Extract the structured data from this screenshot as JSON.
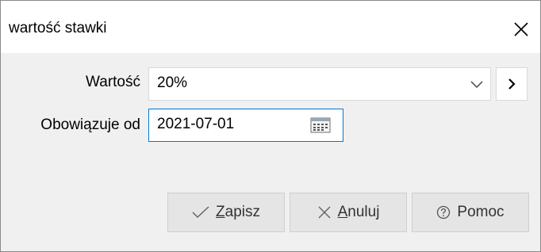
{
  "dialog": {
    "title": "wartość stawki"
  },
  "form": {
    "value_label": "Wartość",
    "value": "20%",
    "valid_from_label": "Obowiązuje od",
    "valid_from": "2021-07-01"
  },
  "buttons": {
    "save_first": "Z",
    "save_rest": "apisz",
    "cancel_first": "A",
    "cancel_rest": "nuluj",
    "help": "Pomoc"
  },
  "icons": {
    "close": "close-icon",
    "dropdown": "chevron-down-icon",
    "next": "chevron-right-icon",
    "calendar": "calendar-icon",
    "save": "check-icon",
    "cancel": "x-icon",
    "help": "question-circle-icon"
  },
  "colors": {
    "focus_border": "#0078d7",
    "button_bg": "#e5e5e5",
    "panel_bg": "#f0f0f0"
  }
}
